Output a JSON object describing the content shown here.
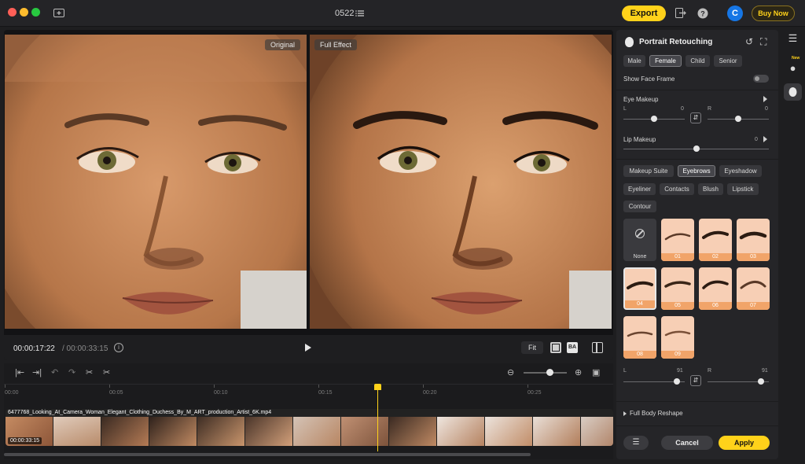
{
  "window": {
    "project_name": "0522",
    "export_label": "Export",
    "buy_label": "Buy Now",
    "avatar_letter": "C"
  },
  "preview": {
    "original_tag": "Original",
    "full_effect_tag": "Full Effect",
    "current_time": "00:00:17:22",
    "total_time": "/ 00:00:33:15",
    "fit_label": "Fit",
    "compare_label": "BA"
  },
  "timeline": {
    "ticks": [
      "00:00",
      "00:05",
      "00:10",
      "00:15",
      "00:20",
      "00:25"
    ],
    "clip_name": "6477768_Looking_At_Camera_Woman_Elegant_Clothing_Duchess_By_M_ART_production_Artist_6K.mp4",
    "clip_duration": "00:00:33:15",
    "zoom_fraction": 0.6
  },
  "panel": {
    "title": "Portrait Retouching",
    "genders": [
      "Male",
      "Female",
      "Child",
      "Senior"
    ],
    "selected_gender": "Female",
    "show_face_frame": "Show Face Frame",
    "eye_makeup": {
      "label": "Eye Makeup",
      "left_label": "L",
      "left_value": "0",
      "right_label": "R",
      "right_value": "0"
    },
    "lip_makeup": {
      "label": "Lip Makeup",
      "value": "0"
    },
    "categories": [
      "Makeup Suite",
      "Eyebrows",
      "Eyeshadow",
      "Eyeliner",
      "Contacts",
      "Blush",
      "Lipstick",
      "Contour"
    ],
    "selected_category": "Eyebrows",
    "none_label": "None",
    "eyebrow_styles": [
      "01",
      "02",
      "03",
      "04",
      "05",
      "06",
      "07",
      "08",
      "09"
    ],
    "selected_style": "04",
    "intensity": {
      "left_label": "L",
      "left_value": "91",
      "right_label": "R",
      "right_value": "91"
    },
    "full_body_reshape": "Full Body Reshape",
    "cancel_label": "Cancel",
    "apply_label": "Apply"
  },
  "rail": {
    "new_badge": "New"
  },
  "colors": {
    "accent": "#ffd21a",
    "skin": "#c98a5c",
    "card_bg": "#f7cfb5",
    "card_label": "#f1a469"
  }
}
